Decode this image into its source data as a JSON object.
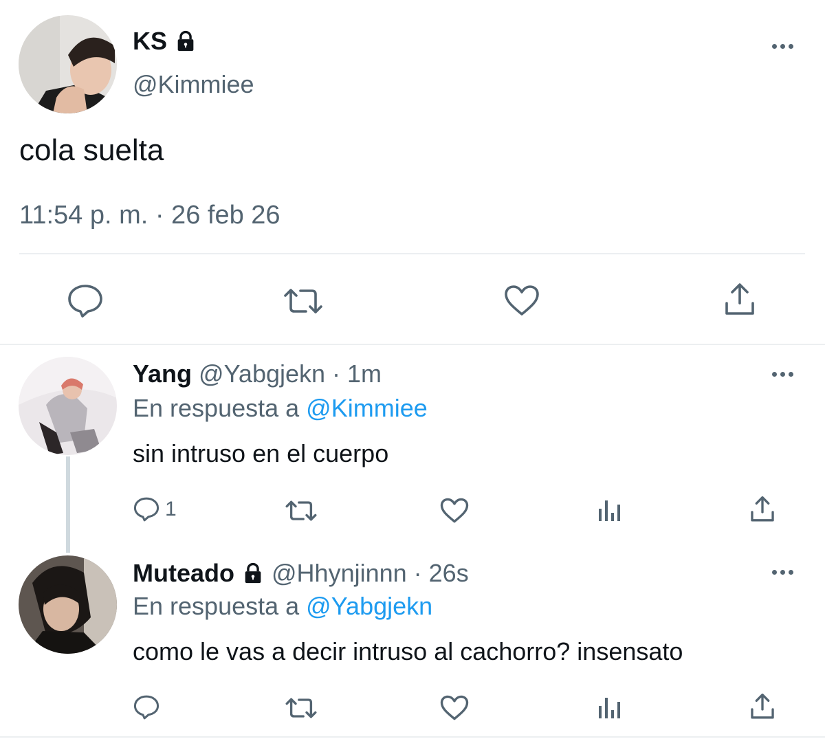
{
  "main_tweet": {
    "display_name": "KS",
    "handle": "@Kimmiee",
    "text": "cola suelta",
    "timestamp": "11:54 p. m. · 26 feb 26",
    "protected": true
  },
  "replies": [
    {
      "display_name": "Yang",
      "handle": "@Yabgjekn",
      "time": "· 1m",
      "reply_prefix": "En respuesta a",
      "reply_to": "@Kimmiee",
      "text": "sin intruso en el cuerpo",
      "reply_count": "1",
      "protected": false
    },
    {
      "display_name": "Muteado",
      "handle": "@Hhynjinnn",
      "time": "· 26s",
      "reply_prefix": "En respuesta a",
      "reply_to": "@Yabgjekn",
      "text": "como le vas a decir intruso al cachorro? insensato",
      "reply_count": "",
      "protected": true
    }
  ],
  "icons": {
    "more": "more-horizontal-icon",
    "reply": "reply-bubble-icon",
    "retweet": "retweet-icon",
    "like": "heart-icon",
    "views": "analytics-bars-icon",
    "share": "share-upload-icon",
    "lock": "lock-icon"
  },
  "colors": {
    "text": "#0f1419",
    "secondary": "#536471",
    "link": "#1d9bf0",
    "divider": "#eceff1"
  }
}
